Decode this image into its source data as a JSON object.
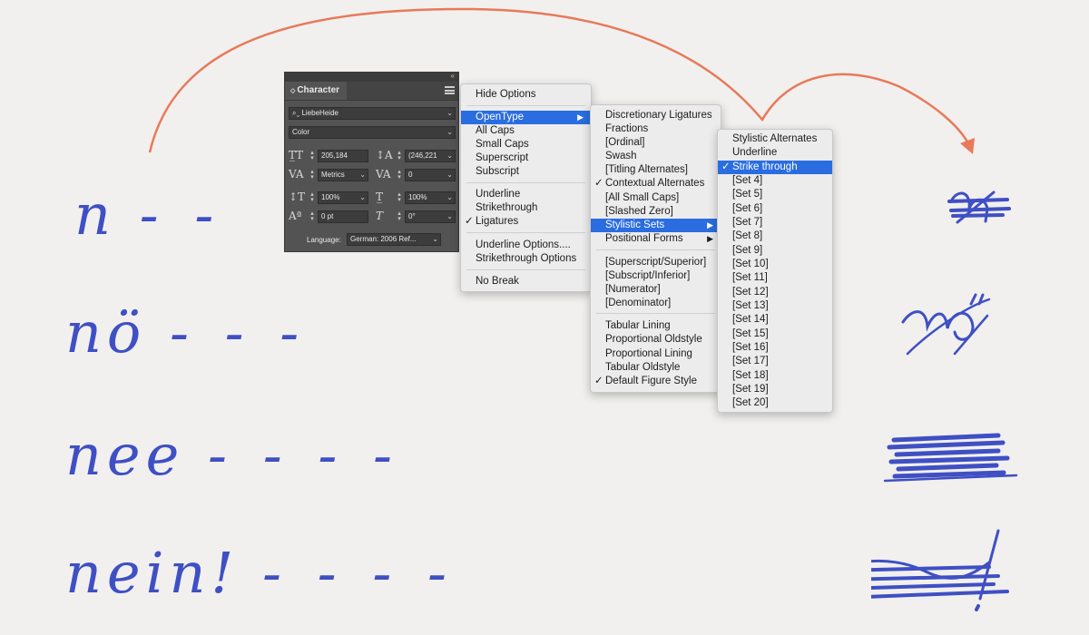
{
  "handwriting": {
    "left": [
      {
        "word": "n",
        "dashes": "- -"
      },
      {
        "word": "nö",
        "dashes": "- - -"
      },
      {
        "word": "nee",
        "dashes": "- - - -"
      },
      {
        "word": "nein!",
        "dashes": "- - - -"
      }
    ]
  },
  "colors": {
    "ink": "#3f4fc4",
    "arrow": "#e8795a",
    "highlight": "#2a6de0",
    "panel": "#535353"
  },
  "character_panel": {
    "title": "Character",
    "font_family": "LiebeHeide",
    "font_style": "Color",
    "font_size": "205,184",
    "leading": "(246,221",
    "kerning": "Metrics",
    "tracking": "0",
    "vertical_scale": "100%",
    "horizontal_scale": "100%",
    "baseline_shift": "0 pt",
    "skew": "0°",
    "language_label": "Language:",
    "language": "German: 2006 Ref..."
  },
  "main_menu": {
    "items": [
      {
        "label": "Hide Options",
        "checked": false,
        "submenu": false,
        "highlighted": false
      },
      {
        "label": "OpenType",
        "checked": false,
        "submenu": true,
        "highlighted": true
      },
      {
        "label": "All Caps",
        "checked": false,
        "submenu": false,
        "highlighted": false
      },
      {
        "label": "Small Caps",
        "checked": false,
        "submenu": false,
        "highlighted": false
      },
      {
        "label": "Superscript",
        "checked": false,
        "submenu": false,
        "highlighted": false
      },
      {
        "label": "Subscript",
        "checked": false,
        "submenu": false,
        "highlighted": false
      },
      {
        "label": "Underline",
        "checked": false,
        "submenu": false,
        "highlighted": false
      },
      {
        "label": "Strikethrough",
        "checked": false,
        "submenu": false,
        "highlighted": false
      },
      {
        "label": "Ligatures",
        "checked": true,
        "submenu": false,
        "highlighted": false
      },
      {
        "label": "Underline Options....",
        "checked": false,
        "submenu": false,
        "highlighted": false
      },
      {
        "label": "Strikethrough Options",
        "checked": false,
        "submenu": false,
        "highlighted": false
      },
      {
        "label": "No Break",
        "checked": false,
        "submenu": false,
        "highlighted": false
      }
    ]
  },
  "opentype_menu": {
    "items": [
      {
        "label": "Discretionary Ligatures",
        "checked": false,
        "submenu": false,
        "highlighted": false
      },
      {
        "label": "Fractions",
        "checked": false,
        "submenu": false,
        "highlighted": false
      },
      {
        "label": "[Ordinal]",
        "checked": false,
        "submenu": false,
        "highlighted": false
      },
      {
        "label": "Swash",
        "checked": false,
        "submenu": false,
        "highlighted": false
      },
      {
        "label": "[Titling Alternates]",
        "checked": false,
        "submenu": false,
        "highlighted": false
      },
      {
        "label": "Contextual Alternates",
        "checked": true,
        "submenu": false,
        "highlighted": false
      },
      {
        "label": "[All Small Caps]",
        "checked": false,
        "submenu": false,
        "highlighted": false
      },
      {
        "label": "[Slashed Zero]",
        "checked": false,
        "submenu": false,
        "highlighted": false
      },
      {
        "label": "Stylistic Sets",
        "checked": false,
        "submenu": true,
        "highlighted": true
      },
      {
        "label": "Positional Forms",
        "checked": false,
        "submenu": true,
        "highlighted": false
      },
      {
        "label": "[Superscript/Superior]",
        "checked": false,
        "submenu": false,
        "highlighted": false
      },
      {
        "label": "[Subscript/Inferior]",
        "checked": false,
        "submenu": false,
        "highlighted": false
      },
      {
        "label": "[Numerator]",
        "checked": false,
        "submenu": false,
        "highlighted": false
      },
      {
        "label": "[Denominator]",
        "checked": false,
        "submenu": false,
        "highlighted": false
      },
      {
        "label": "Tabular Lining",
        "checked": false,
        "submenu": false,
        "highlighted": false
      },
      {
        "label": "Proportional Oldstyle",
        "checked": false,
        "submenu": false,
        "highlighted": false
      },
      {
        "label": "Proportional Lining",
        "checked": false,
        "submenu": false,
        "highlighted": false
      },
      {
        "label": "Tabular Oldstyle",
        "checked": false,
        "submenu": false,
        "highlighted": false
      },
      {
        "label": "Default Figure Style",
        "checked": true,
        "submenu": false,
        "highlighted": false
      }
    ]
  },
  "stylistic_sets_menu": {
    "items": [
      {
        "label": "Stylistic Alternates",
        "checked": false,
        "highlighted": false
      },
      {
        "label": "Underline",
        "checked": false,
        "highlighted": false
      },
      {
        "label": "Strike through",
        "checked": true,
        "highlighted": true
      },
      {
        "label": "[Set 4]",
        "checked": false,
        "highlighted": false
      },
      {
        "label": "[Set 5]",
        "checked": false,
        "highlighted": false
      },
      {
        "label": "[Set 6]",
        "checked": false,
        "highlighted": false
      },
      {
        "label": "[Set 7]",
        "checked": false,
        "highlighted": false
      },
      {
        "label": "[Set 8]",
        "checked": false,
        "highlighted": false
      },
      {
        "label": "[Set 9]",
        "checked": false,
        "highlighted": false
      },
      {
        "label": "[Set 10]",
        "checked": false,
        "highlighted": false
      },
      {
        "label": "[Set 11]",
        "checked": false,
        "highlighted": false
      },
      {
        "label": "[Set 12]",
        "checked": false,
        "highlighted": false
      },
      {
        "label": "[Set 13]",
        "checked": false,
        "highlighted": false
      },
      {
        "label": "[Set 14]",
        "checked": false,
        "highlighted": false
      },
      {
        "label": "[Set 15]",
        "checked": false,
        "highlighted": false
      },
      {
        "label": "[Set 16]",
        "checked": false,
        "highlighted": false
      },
      {
        "label": "[Set 17]",
        "checked": false,
        "highlighted": false
      },
      {
        "label": "[Set 18]",
        "checked": false,
        "highlighted": false
      },
      {
        "label": "[Set 19]",
        "checked": false,
        "highlighted": false
      },
      {
        "label": "[Set 20]",
        "checked": false,
        "highlighted": false
      }
    ]
  }
}
